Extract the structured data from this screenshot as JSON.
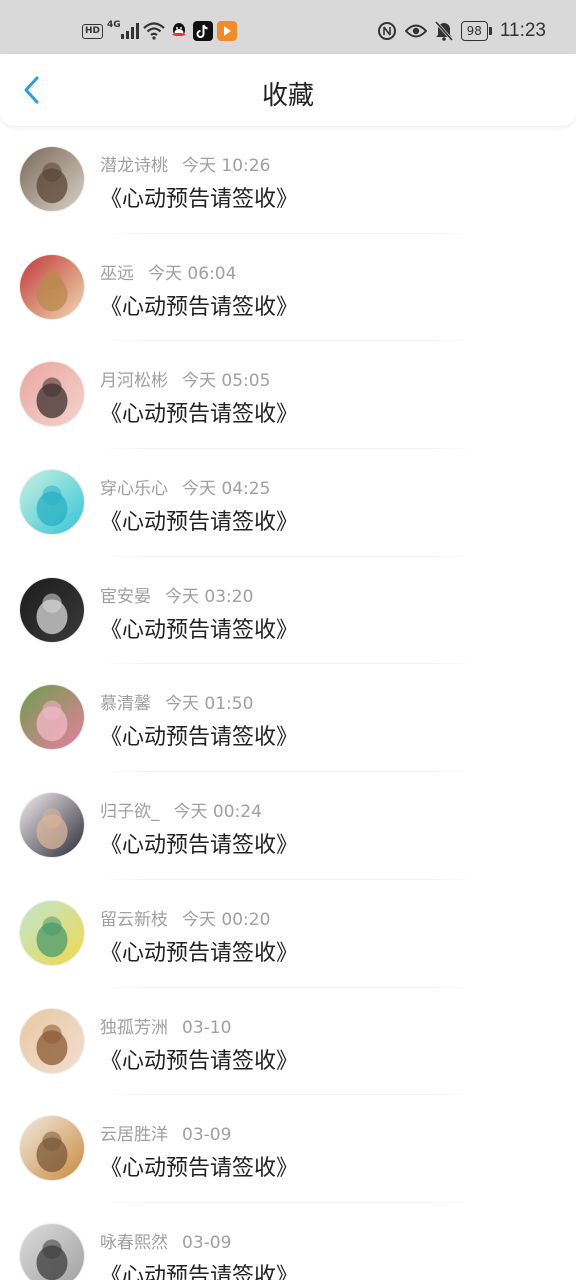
{
  "status_bar": {
    "left_icons": [
      {
        "icon": "hd-icon",
        "text": "HD"
      },
      {
        "icon": "signal-4g-icon",
        "text": "4G"
      },
      {
        "icon": "wifi-icon"
      },
      {
        "icon": "qq-icon"
      },
      {
        "icon": "tiktok-icon"
      },
      {
        "icon": "app-icon"
      }
    ],
    "right_icons": [
      {
        "icon": "nfc-icon"
      },
      {
        "icon": "eye-icon"
      },
      {
        "icon": "mute-bell-icon"
      }
    ],
    "battery": "98",
    "time": "11:23"
  },
  "header": {
    "back_icon": "chevron-left-icon",
    "title": "收藏",
    "accent_color": "#2c9be8"
  },
  "favorites": [
    {
      "name": "潜龙诗桃",
      "time": "今天 10:26",
      "title": "《心动预告请签收》",
      "avatar_colors": [
        "#7a6a5a",
        "#d8d0c4",
        "#5a4636"
      ]
    },
    {
      "name": "巫远",
      "time": "今天 06:04",
      "title": "《心动预告请签收》",
      "avatar_colors": [
        "#c23a3a",
        "#f0d9b0",
        "#b88a4c"
      ]
    },
    {
      "name": "月河松彬",
      "time": "今天 05:05",
      "title": "《心动预告请签收》",
      "avatar_colors": [
        "#e9a7a0",
        "#f4d3cc",
        "#3e2f2f"
      ]
    },
    {
      "name": "穿心乐心",
      "time": "今天 04:25",
      "title": "《心动预告请签收》",
      "avatar_colors": [
        "#c9f0e0",
        "#35c4d8",
        "#2ab0c4"
      ]
    },
    {
      "name": "宦安晏",
      "time": "今天 03:20",
      "title": "《心动预告请签收》",
      "avatar_colors": [
        "#1c1c1c",
        "#3a3a3a",
        "#d8d8d8"
      ]
    },
    {
      "name": "慕清馨",
      "time": "今天 01:50",
      "title": "《心动预告请签收》",
      "avatar_colors": [
        "#6c9e4c",
        "#e87fa0",
        "#f3b8c8"
      ]
    },
    {
      "name": "归子欲_",
      "time": "今天 00:24",
      "title": "《心动预告请签收》",
      "avatar_colors": [
        "#f3eeee",
        "#2b2b3a",
        "#d9b59a"
      ]
    },
    {
      "name": "留云新枝",
      "time": "今天 00:20",
      "title": "《心动预告请签收》",
      "avatar_colors": [
        "#bfe6d2",
        "#f0d84a",
        "#4a9b6c"
      ]
    },
    {
      "name": "独孤芳洲",
      "time": "03-10",
      "title": "《心动预告请签收》",
      "avatar_colors": [
        "#e8c9a0",
        "#f2ddd0",
        "#8a5a34"
      ]
    },
    {
      "name": "云居胜洋",
      "time": "03-09",
      "title": "《心动预告请签收》",
      "avatar_colors": [
        "#f2e9e0",
        "#c98a3c",
        "#7a5a3a"
      ]
    },
    {
      "name": "咏春熙然",
      "time": "03-09",
      "title": "《心动预告请签收》",
      "avatar_colors": [
        "#dcdcdc",
        "#a0a0a0",
        "#3c3c3c"
      ]
    }
  ]
}
